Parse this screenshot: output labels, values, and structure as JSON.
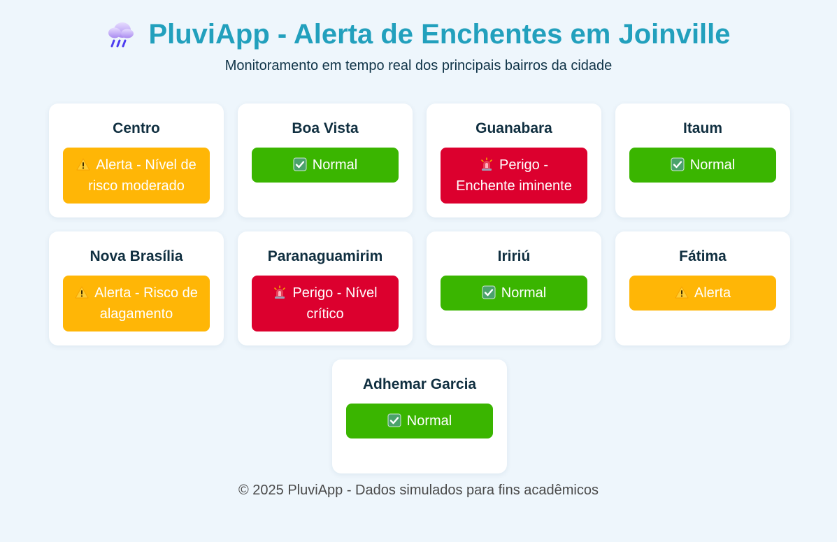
{
  "header": {
    "title": "PluviApp - Alerta de Enchentes em Joinville",
    "subtitle": "Monitoramento em tempo real dos principais bairros da cidade",
    "icon": "rain-cloud-icon"
  },
  "neighborhoods": [
    {
      "name": "Centro",
      "status": "alert",
      "icon": "warning-icon",
      "label": "Alerta - Nível de risco moderado"
    },
    {
      "name": "Boa Vista",
      "status": "normal",
      "icon": "checkmark-icon",
      "label": "Normal"
    },
    {
      "name": "Guanabara",
      "status": "danger",
      "icon": "siren-icon",
      "label": "Perigo - Enchente iminente"
    },
    {
      "name": "Itaum",
      "status": "normal",
      "icon": "checkmark-icon",
      "label": "Normal"
    },
    {
      "name": "Nova Brasília",
      "status": "alert",
      "icon": "warning-icon",
      "label": "Alerta - Risco de alagamento"
    },
    {
      "name": "Paranaguamirim",
      "status": "danger",
      "icon": "siren-icon",
      "label": "Perigo - Nível crítico"
    },
    {
      "name": "Iririú",
      "status": "normal",
      "icon": "checkmark-icon",
      "label": "Normal"
    },
    {
      "name": "Fátima",
      "status": "alert",
      "icon": "warning-icon",
      "label": "Alerta"
    },
    {
      "name": "Adhemar Garcia",
      "status": "normal",
      "icon": "checkmark-icon",
      "label": "Normal"
    }
  ],
  "colors": {
    "title": "#22a0bd",
    "normal": "#3ab500",
    "alert": "#ffb606",
    "danger": "#dc002e",
    "background": "#eef6fc"
  },
  "footer": {
    "text": "© 2025 PluviApp - Dados simulados para fins acadêmicos"
  }
}
